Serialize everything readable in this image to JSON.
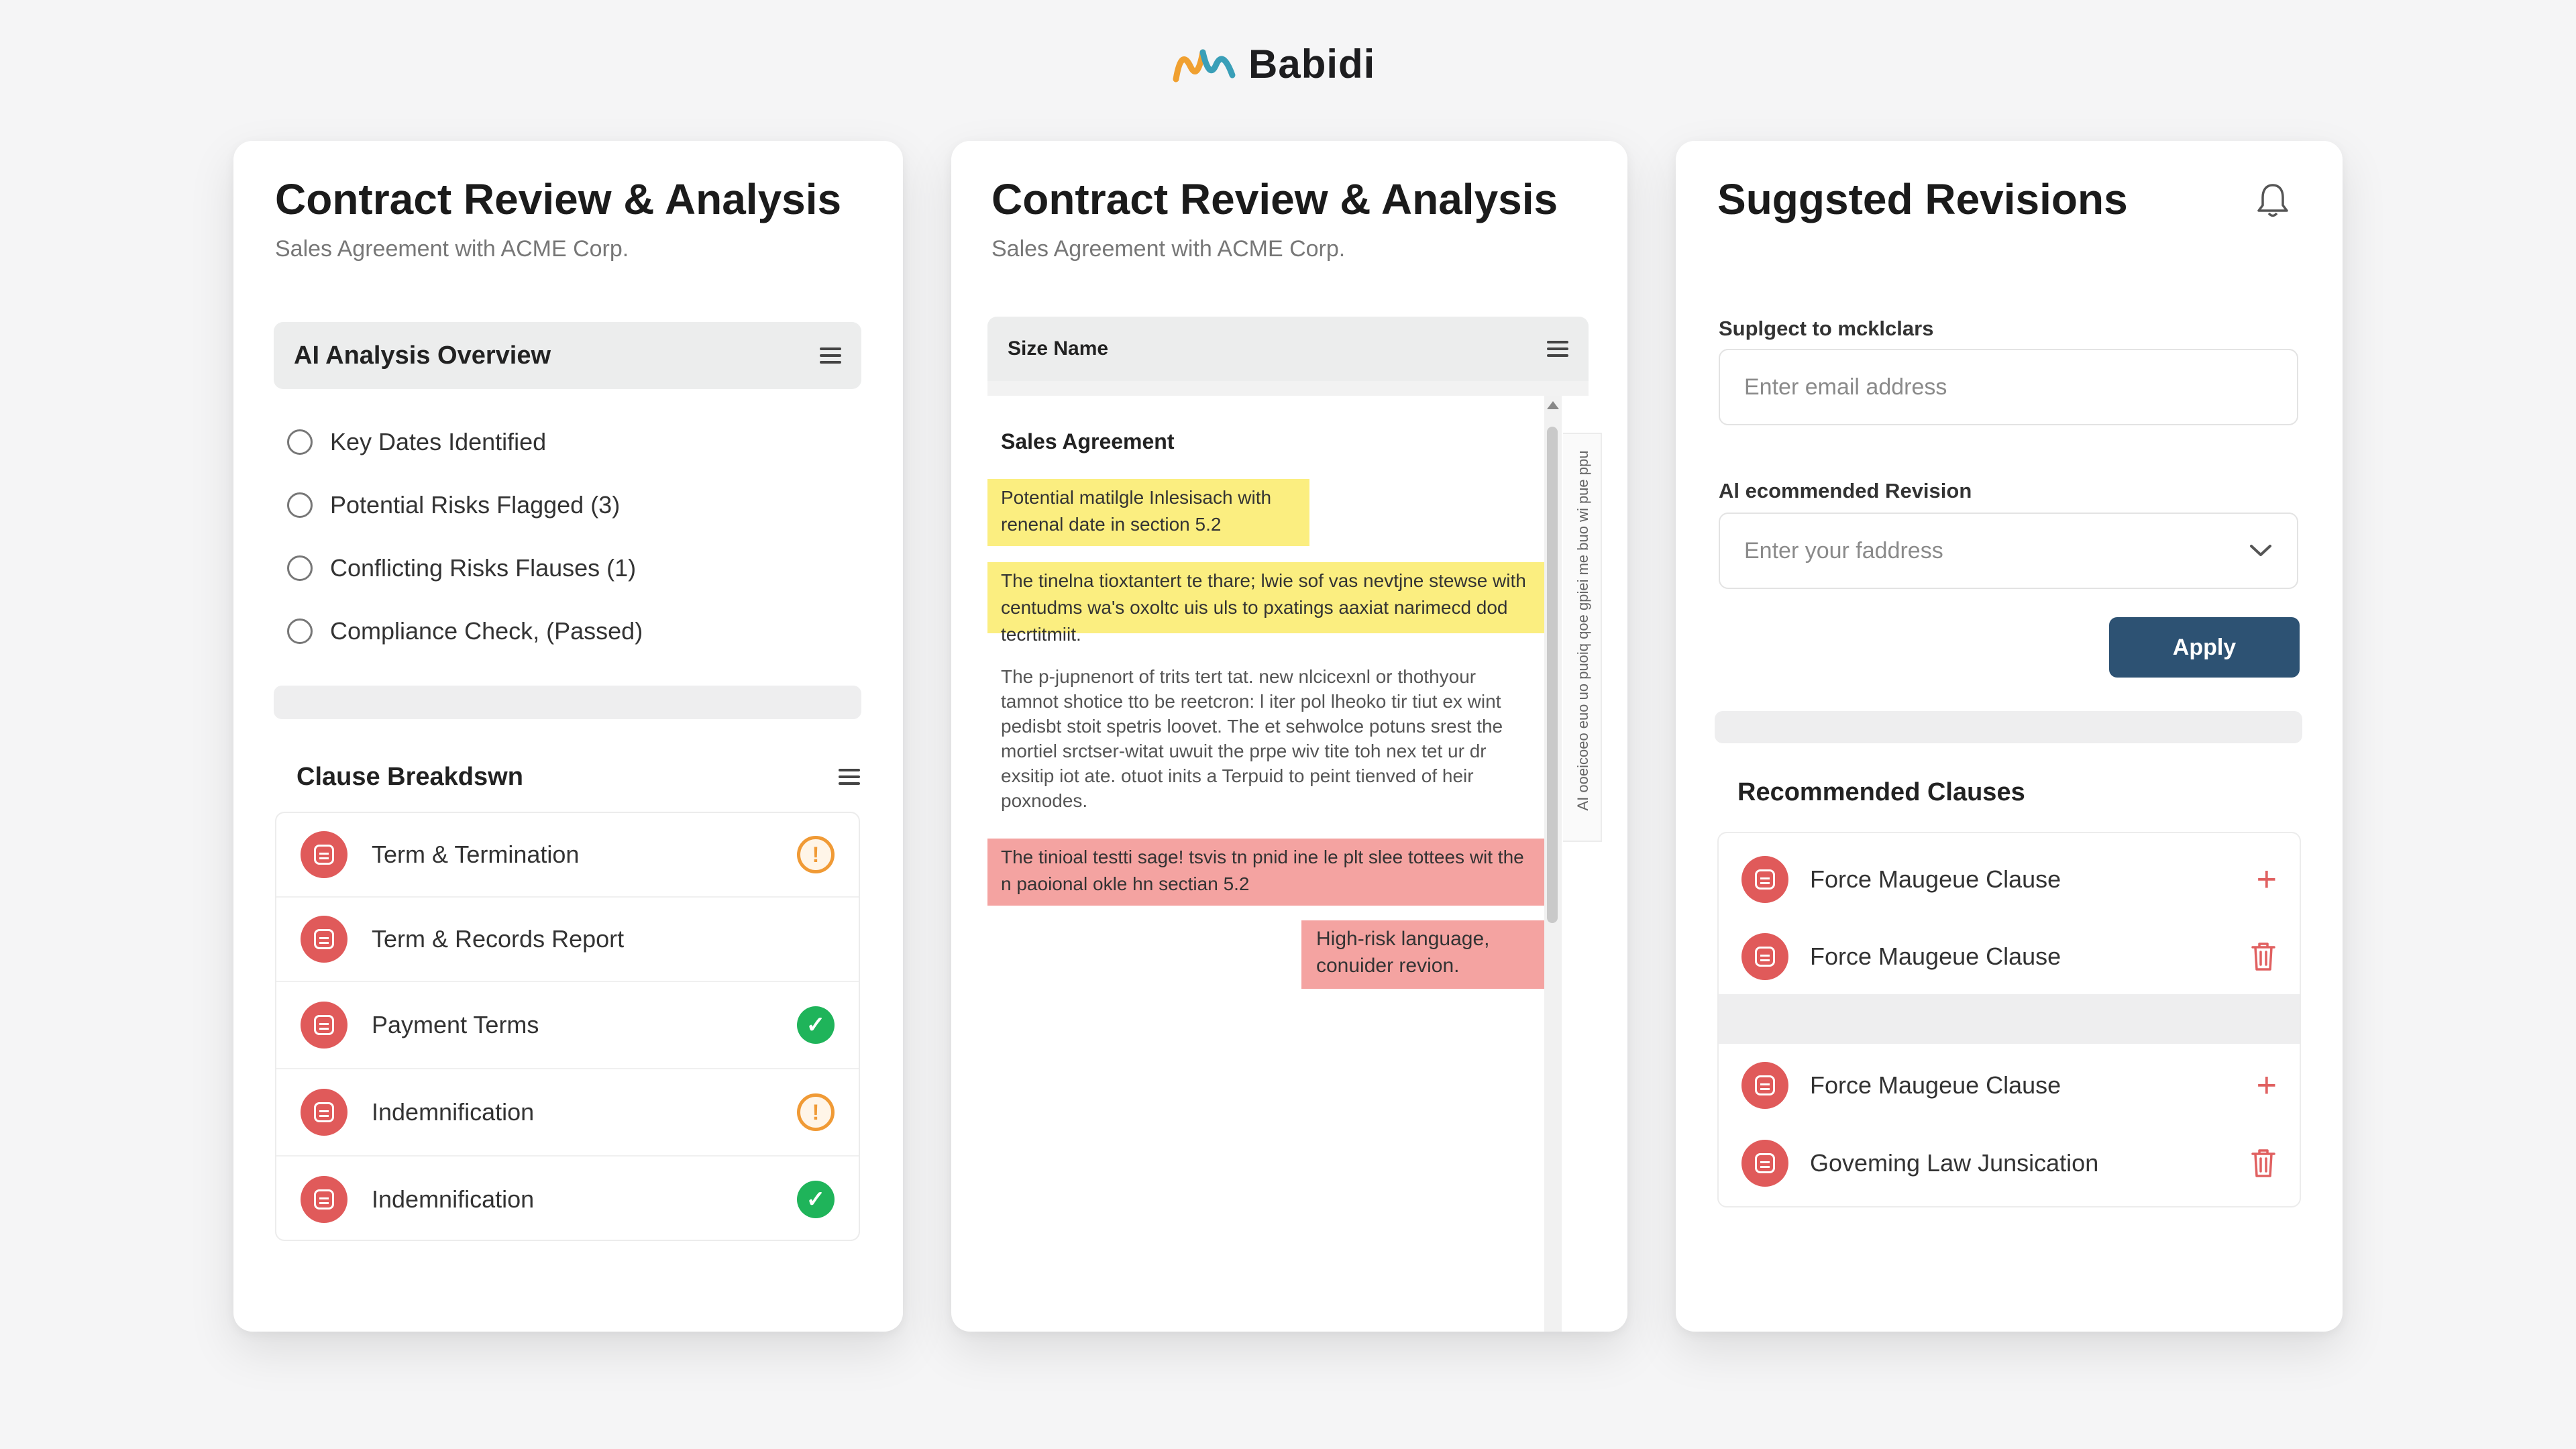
{
  "brand": {
    "name": "Babidi",
    "logo_icon": "babidi-logo-icon"
  },
  "panel1": {
    "title": "Contract Review & Analysis",
    "subtitle": "Sales Agreement with ACME Corp.",
    "overview": {
      "header": "AI Analysis Overview",
      "items": [
        {
          "label": "Key Dates Identified"
        },
        {
          "label": "Potential Risks Flagged (3)"
        },
        {
          "label": "Conflicting Risks Flauses (1)"
        },
        {
          "label": "Compliance Check, (Passed)"
        }
      ]
    },
    "clauses": {
      "header": "Clause Breakdswn",
      "items": [
        {
          "label": "Term & Termination",
          "status": "warning"
        },
        {
          "label": "Term & Records Report",
          "status": "none"
        },
        {
          "label": "Payment Terms",
          "status": "ok"
        },
        {
          "label": "Indemnification",
          "status": "warning"
        },
        {
          "label": "Indemnification",
          "status": "ok"
        }
      ],
      "status_glyphs": {
        "warning": "!",
        "ok": "✓"
      },
      "colors": {
        "warning": "#f09a35",
        "ok": "#1fb45a",
        "clause_icon": "#e05a5a"
      }
    }
  },
  "panel2": {
    "title": "Contract Review & Analysis",
    "subtitle": "Sales Agreement with ACME Corp.",
    "toolbar_label": "Size Name",
    "doc_title": "Sales Agreement",
    "highlight1": "Potential matilgle Inlesisach with renenal date in section 5.2",
    "highlight2": "The tinelna tioxtantert te thare; lwie sof vas nevtjne stewse with centudms wa's oxoltc uis uls to pxatings aaxiat narimecd dod tecrtitmiit.",
    "body": "The p-jupnenort of trits tert tat. new nlcicexnl or thothyour tamnot shotice tto be reetcron: l iter pol lheoko tir tiut ex wint pedisbt stoit spetris loovet. The et sehwolce potuns srest the mortiel srctser-witat uwuit the prpe wiv tite toh nex tet ur dr exsitip iot ate. otuot inits a Terpuid to peint tienved of heir poxnodes.",
    "highlight3": "The tinioal testti sage! tsvis tn pnid ine le plt slee tottees wit the n paoional okle hn sectian 5.2",
    "comment": "High-risk language, conuider revion.",
    "side_text": "AI ooeicoeo euo uo puoiq qoe gpiei me buo wi pue ppu"
  },
  "panel3": {
    "title": "Suggsted Revisions",
    "field1_label": "Suplgect to mcklclars",
    "field1_placeholder": "Enter email address",
    "field2_label": "Al ecommended Revision",
    "field2_placeholder": "Enter your faddress",
    "apply_label": "Apply",
    "apply_color": "#2d5273",
    "recommended_header": "Recommended Clauses",
    "group1": [
      {
        "label": "Force Maugeue Clause",
        "action": "+",
        "action_icon": "plus-icon"
      },
      {
        "label": "Force Maugeue Clause",
        "action": "",
        "action_icon": "trash-icon"
      }
    ],
    "group2": [
      {
        "label": "Force Maugeue Clause",
        "action": "+",
        "action_icon": "plus-icon"
      },
      {
        "label": "Goveming Law Junsication",
        "action": "",
        "action_icon": "trash-icon"
      }
    ]
  }
}
